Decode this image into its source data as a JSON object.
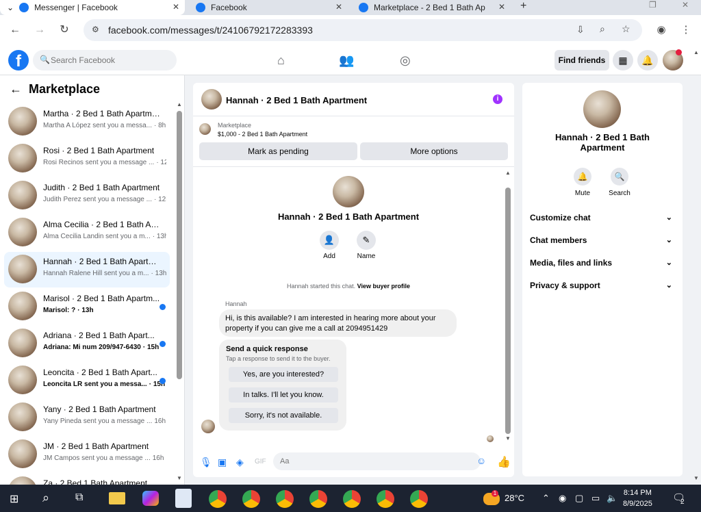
{
  "browser": {
    "tabs": [
      {
        "title": "Messenger | Facebook",
        "active": true
      },
      {
        "title": "Facebook",
        "active": false
      },
      {
        "title": "Marketplace - 2 Bed 1 Bath Ap",
        "active": false
      }
    ],
    "url": "facebook.com/messages/t/24106792172283393"
  },
  "fb_header": {
    "logo": "f",
    "search_placeholder": "Search Facebook",
    "find_friends": "Find friends"
  },
  "marketplace": {
    "title": "Marketplace",
    "conversations": [
      {
        "name": "Martha · 2 Bed 1 Bath Apartment",
        "snippet": "Martha A López sent you a messa...",
        "time": "· 8h",
        "unread": false,
        "selected": false
      },
      {
        "name": "Rosi · 2 Bed 1 Bath Apartment",
        "snippet": "Rosi Recinos sent you a message ...",
        "time": "· 12h",
        "unread": false,
        "selected": false
      },
      {
        "name": "Judith · 2 Bed 1 Bath Apartment",
        "snippet": "Judith Perez sent you a message ...",
        "time": "· 12h",
        "unread": false,
        "selected": false
      },
      {
        "name": "Alma Cecilia · 2 Bed 1 Bath Apar...",
        "snippet": "Alma Cecilia Landin sent you a m...",
        "time": "· 13h",
        "unread": false,
        "selected": false
      },
      {
        "name": "Hannah · 2 Bed 1 Bath Apartment",
        "snippet": "Hannah Ralene Hill sent you a m...",
        "time": "· 13h",
        "unread": false,
        "selected": true
      },
      {
        "name": "Marisol · 2 Bed 1 Bath Apartm...",
        "snippet": "Marisol: ?",
        "time": "· 13h",
        "unread": true,
        "selected": false
      },
      {
        "name": "Adriana · 2 Bed 1 Bath Apart...",
        "snippet": "Adriana: Mi num 209/947-6430",
        "time": "· 15h",
        "unread": true,
        "selected": false
      },
      {
        "name": "Leoncita · 2 Bed 1 Bath Apart...",
        "snippet": "Leoncita LR sent you a messa...",
        "time": "· 15h",
        "unread": true,
        "selected": false
      },
      {
        "name": "Yany · 2 Bed 1 Bath Apartment",
        "snippet": "Yany Pineda sent you a message ...",
        "time": "16h",
        "unread": false,
        "selected": false
      },
      {
        "name": "JM · 2 Bed 1 Bath Apartment",
        "snippet": "JM Campos sent you a message ...",
        "time": "16h",
        "unread": false,
        "selected": false
      },
      {
        "name": "Za · 2 Bed 1 Bath Apartment",
        "snippet": "",
        "time": "",
        "unread": false,
        "selected": false
      }
    ]
  },
  "chat": {
    "title": "Hannah · 2 Bed 1 Bath Apartment",
    "listing_category": "Marketplace",
    "listing_price": "$1,000 - 2 Bed 1 Bath Apartment",
    "mark_pending": "Mark as pending",
    "more_options": "More options",
    "profile_name": "Hannah · 2 Bed 1 Bath Apartment",
    "add_label": "Add",
    "name_label": "Name",
    "started_text": "Hannah started this chat.",
    "view_buyer": "View buyer profile",
    "sender": "Hannah",
    "message": "Hi, is this available? I am interested in hearing more about your property if you can give me a call at 2094951429",
    "quick_title": "Send a quick response",
    "quick_subtitle": "Tap a response to send it to the buyer.",
    "quick_responses": [
      "Yes, are you interested?",
      "In talks. I'll let you know.",
      "Sorry, it's not available."
    ],
    "composer_placeholder": "Aa"
  },
  "info_panel": {
    "name_line1": "Hannah · 2 Bed 1 Bath",
    "name_line2": "Apartment",
    "mute": "Mute",
    "search": "Search",
    "rows": [
      "Customize chat",
      "Chat members",
      "Media, files and links",
      "Privacy & support"
    ]
  },
  "taskbar": {
    "weather": "28°C",
    "time": "8:14 PM",
    "date": "8/9/2025",
    "notif_count": "2",
    "badge": "1"
  },
  "colors": {
    "fb_blue": "#1877f2",
    "selected_bg": "#ebf5ff",
    "info_purple": "#a033ff"
  }
}
